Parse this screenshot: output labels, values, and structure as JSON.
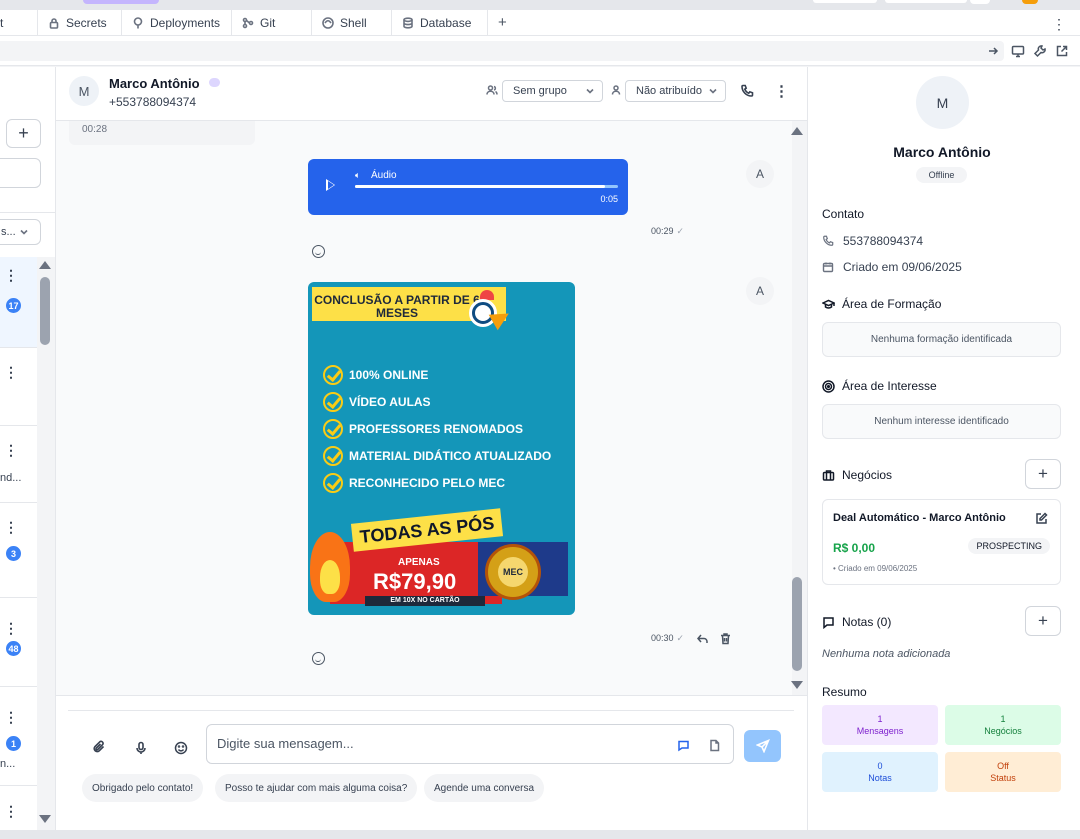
{
  "tabs": [
    {
      "label": "t",
      "icon": "partial-tab"
    },
    {
      "label": "Secrets",
      "icon": "lock-icon"
    },
    {
      "label": "Deployments",
      "icon": "tree-icon"
    },
    {
      "label": "Git",
      "icon": "git-icon"
    },
    {
      "label": "Shell",
      "icon": "shell-icon"
    },
    {
      "label": "Database",
      "icon": "database-icon"
    }
  ],
  "left": {
    "filter_label": "s...",
    "conversations": [
      {
        "badge": "17"
      },
      {
        "badge": ""
      },
      {
        "badge": "",
        "snippet": "nd..."
      },
      {
        "badge": "3"
      },
      {
        "badge": "48"
      },
      {
        "badge": "1",
        "snippet": "n..."
      }
    ]
  },
  "chat": {
    "avatar": "M",
    "name": "Marco Antônio",
    "phone": "+553788094374",
    "group_select": "Sem grupo",
    "assign_select": "Não atribuído",
    "old_time": "00:28",
    "audio": {
      "label": "Áudio",
      "duration": "0:05",
      "progress": 0.95
    },
    "audio_time": "00:29",
    "image_time": "00:30",
    "bubble_avatar": "A",
    "image": {
      "headline": "CONCLUSÃO A PARTIR DE 6 MESES",
      "items": [
        "100% ONLINE",
        "VÍDEO AULAS",
        "PROFESSORES RENOMADOS",
        "MATERIAL DIDÁTICO ATUALIZADO",
        "RECONHECIDO PELO MEC"
      ],
      "banner": "TODAS AS PÓS",
      "apenas": "APENAS",
      "price": "R$79,90",
      "installments": "EM 10X NO CARTÃO",
      "seal": "MEC"
    },
    "composer": {
      "placeholder": "Digite sua mensagem...",
      "suggestions": [
        "Obrigado pelo contato!",
        "Posso te ajudar com mais alguma coisa?",
        "Agende uma conversa"
      ]
    }
  },
  "contact": {
    "avatar": "M",
    "name": "Marco Antônio",
    "status": "Offline",
    "section_contact": "Contato",
    "phone": "553788094374",
    "created": "Criado em 09/06/2025",
    "formation_title": "Área de Formação",
    "formation_empty": "Nenhuma formação identificada",
    "interest_title": "Área de Interesse",
    "interest_empty": "Nenhum interesse identificado",
    "deals_title": "Negócios",
    "deal": {
      "title": "Deal Automático - Marco Antônio",
      "value": "R$ 0,00",
      "stage": "PROSPECTING",
      "date": "• Criado em 09/06/2025"
    },
    "notes_title": "Notas (0)",
    "notes_empty": "Nenhuma nota adicionada",
    "summary_title": "Resumo",
    "summary": [
      {
        "value": "1",
        "label": "Mensagens",
        "bg": "#f3e8ff",
        "color": "#7e22ce"
      },
      {
        "value": "1",
        "label": "Negócios",
        "bg": "#dcfce7",
        "color": "#15803d"
      },
      {
        "value": "0",
        "label": "Notas",
        "bg": "#e0f2fe",
        "color": "#1d4ed8"
      },
      {
        "value": "Off",
        "label": "Status",
        "bg": "#ffedd5",
        "color": "#c2410c"
      }
    ]
  }
}
